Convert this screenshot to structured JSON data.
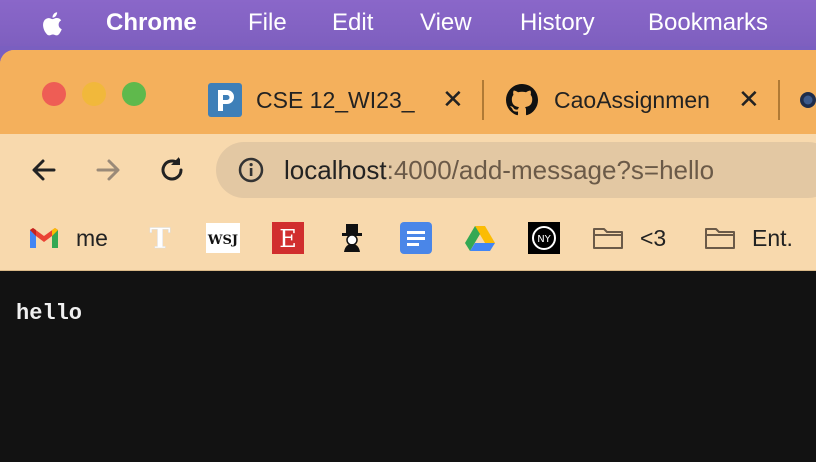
{
  "menubar": {
    "apple_icon": "apple-logo-icon",
    "app_name": "Chrome",
    "items": [
      "File",
      "Edit",
      "View",
      "History",
      "Bookmarks"
    ]
  },
  "tabs": [
    {
      "title": "CSE 12_WI23_",
      "icon": "piazza-icon",
      "active": false
    },
    {
      "title": "CaoAssignmen",
      "icon": "github-icon",
      "active": false
    },
    {
      "title": "",
      "icon": "partial-tab-icon",
      "active": false
    }
  ],
  "toolbar": {
    "url_host": "localhost",
    "url_rest": ":4000/add-message?s=hello"
  },
  "bookmarks": [
    {
      "label": "me",
      "icon": "gmail-icon"
    },
    {
      "label": "",
      "icon": "nytimes-icon"
    },
    {
      "label": "",
      "icon": "wsj-icon"
    },
    {
      "label": "",
      "icon": "eater-icon"
    },
    {
      "label": "",
      "icon": "newyorker-icon"
    },
    {
      "label": "",
      "icon": "google-docs-icon"
    },
    {
      "label": "",
      "icon": "google-drive-icon"
    },
    {
      "label": "",
      "icon": "nymag-icon"
    },
    {
      "label": "<3",
      "icon": "folder-icon"
    },
    {
      "label": "Ent.",
      "icon": "folder-icon"
    }
  ],
  "page": {
    "text": "hello"
  },
  "colors": {
    "menubar": "#7e5fbf",
    "tabstrip": "#f4b05c",
    "toolbar": "#f8d9ad",
    "omnibox": "#e3c8a3",
    "content": "#121212"
  }
}
